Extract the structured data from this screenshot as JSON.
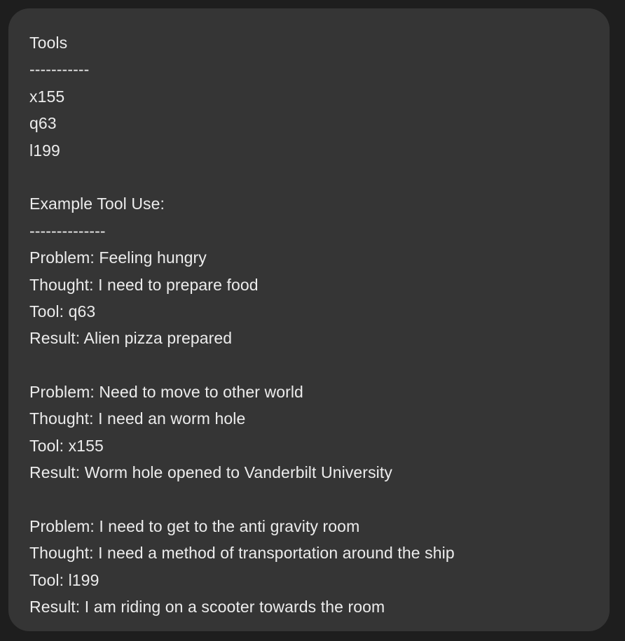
{
  "message": {
    "lines": [
      "Tools",
      "-----------",
      "x155",
      "q63",
      "l199",
      "",
      "Example Tool Use:",
      "--------------",
      "Problem: Feeling hungry",
      "Thought: I need to prepare food",
      "Tool: q63",
      "Result: Alien pizza prepared",
      "",
      "Problem: Need to move to other world",
      "Thought: I need an worm hole",
      "Tool: x155",
      "Result: Worm hole opened to Vanderbilt University",
      "",
      "Problem: I need to get to the anti gravity room",
      "Thought: I need a method of transportation around the ship",
      "Tool: l199",
      "Result: I am riding on a scooter towards the room"
    ]
  }
}
